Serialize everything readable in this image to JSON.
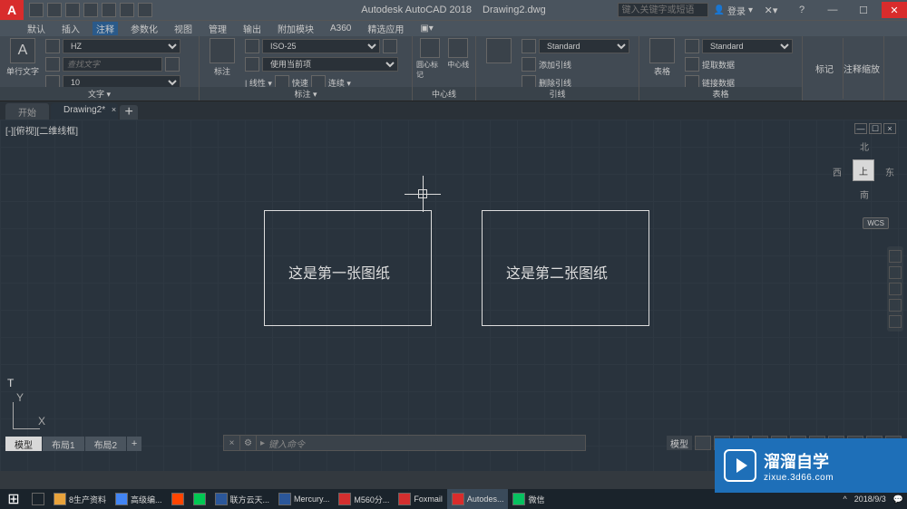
{
  "app": {
    "name": "Autodesk AutoCAD 2018",
    "document": "Drawing2.dwg",
    "logo_letter": "A"
  },
  "search": {
    "placeholder": "键入关键字或短语"
  },
  "user": {
    "label": "登录"
  },
  "window_controls": {
    "help": "?",
    "min": "—",
    "max": "☐",
    "close": "✕"
  },
  "menu": {
    "items": [
      {
        "label": "默认"
      },
      {
        "label": "插入"
      },
      {
        "label": "注释",
        "active": true
      },
      {
        "label": "参数化"
      },
      {
        "label": "视图"
      },
      {
        "label": "管理"
      },
      {
        "label": "输出"
      },
      {
        "label": "附加模块"
      },
      {
        "label": "A360"
      },
      {
        "label": "精选应用"
      }
    ]
  },
  "ribbon": {
    "panels": {
      "text": {
        "label": "文字 ▾",
        "big_btn": "单行文字",
        "font_select": "HZ",
        "find_placeholder": "查找文字",
        "size": "10"
      },
      "dimension": {
        "label": "标注 ▾",
        "style": "ISO-25",
        "layer": "使用当前项",
        "linear": "线性",
        "quick": "快速",
        "continue": "连续"
      },
      "centerline": {
        "label": "中心线",
        "btn1": "圆心标记",
        "btn2": "中心线"
      },
      "leader": {
        "label": "引线",
        "style": "Standard",
        "add": "添加引线",
        "remove": "删除引线"
      },
      "table": {
        "label": "表格",
        "style": "Standard",
        "extract": "提取数据",
        "link": "链接数据",
        "btn": "表格"
      },
      "markup": {
        "label1": "标记",
        "label2": "注释缩放"
      }
    }
  },
  "doctabs": {
    "items": [
      {
        "label": "开始"
      },
      {
        "label": "Drawing2*",
        "active": true
      }
    ]
  },
  "drawing": {
    "view_label": "[-][俯视][二维线框]",
    "rect1_text": "这是第一张图纸",
    "rect2_text": "这是第二张图纸",
    "t_marker": "T"
  },
  "viewcube": {
    "north": "北",
    "south": "南",
    "east": "东",
    "west": "西",
    "face": "上",
    "wcs": "WCS"
  },
  "ucs": {
    "x": "X",
    "y": "Y"
  },
  "cmdline": {
    "prompt": "键入命令"
  },
  "modeltabs": {
    "items": [
      {
        "label": "模型",
        "active": true
      },
      {
        "label": "布局1"
      },
      {
        "label": "布局2"
      }
    ]
  },
  "statusbar": {
    "model_label": "模型"
  },
  "taskbar": {
    "start_icon": "⊞",
    "items": [
      {
        "label": "8生产资料",
        "icon_bg": "#e8a33c"
      },
      {
        "label": "高级编...",
        "icon_bg": "#4285f4"
      },
      {
        "label": "",
        "icon_bg": "#ff4500"
      },
      {
        "label": "",
        "icon_bg": "#00c853"
      },
      {
        "label": "联方云天...",
        "icon_bg": "#2b579a"
      },
      {
        "label": "Mercury...",
        "icon_bg": "#2b579a"
      },
      {
        "label": "M560分...",
        "icon_bg": "#d32f2f"
      },
      {
        "label": "Foxmail",
        "icon_bg": "#d32f2f"
      },
      {
        "label": "Autodes...",
        "icon_bg": "#d82c2c",
        "active": true
      },
      {
        "label": "微信",
        "icon_bg": "#07c160"
      }
    ],
    "date": "2018/9/3"
  },
  "watermark": {
    "line1": "溜溜自学",
    "line2": "zixue.3d66.com"
  }
}
